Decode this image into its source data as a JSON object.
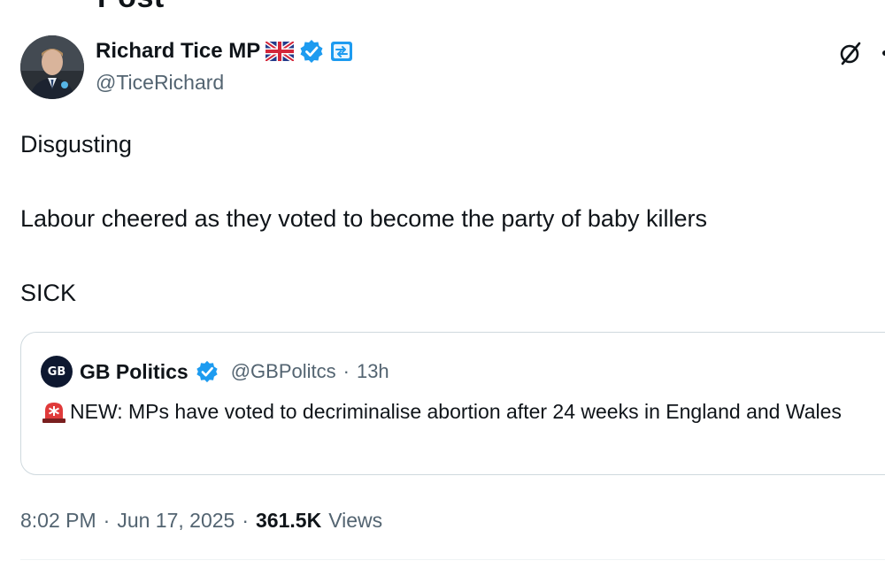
{
  "header": {
    "title": "Post"
  },
  "author": {
    "display_name": "Richard Tice MP",
    "handle": "@TiceRichard",
    "badges": [
      "uk-flag-icon",
      "verified-badge-icon",
      "automated-badge-icon"
    ]
  },
  "tweet": {
    "lines": [
      "Disgusting",
      "Labour cheered as they voted to become the party of baby killers",
      "SICK"
    ]
  },
  "quote": {
    "avatar_text": "GB",
    "display_name": "GB Politics",
    "handle": "@GBPolitcs",
    "separator": "·",
    "time": "13h",
    "icon": "siren-emoji",
    "body": "NEW: MPs have voted to decriminalise abortion after 24 weeks in England and Wales"
  },
  "meta": {
    "time": "8:02 PM",
    "separator": "·",
    "date": "Jun 17, 2025",
    "views_count": "361.5K",
    "views_label": "Views"
  },
  "colors": {
    "text": "#0f1419",
    "secondary": "#536471",
    "verified": "#1d9bf0",
    "border": "#cfd9de"
  }
}
